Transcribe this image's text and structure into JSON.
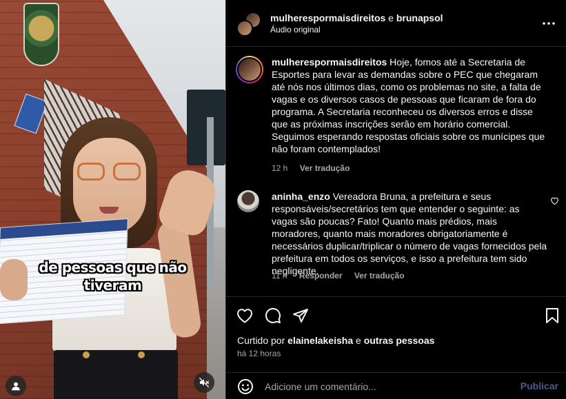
{
  "media": {
    "caption_line1": "de pessoas que não",
    "caption_line2": "tiveram"
  },
  "header": {
    "author": "mulherespormaisdireitos",
    "connector": "e",
    "collaborator": "brunapsol",
    "audio": "Áudio original"
  },
  "post": {
    "username": "mulherespormaisdireitos",
    "text": "Hoje, fomos até a Secretaria de Esportes para levar as demandas sobre o PEC que chegaram até nós nos últimos dias, como os problemas no site, a falta de vagas e os diversos casos de pessoas que ficaram de fora do programa. A Secretaria reconheceu os diversos erros e disse que as próximas inscrições serão em horário comercial. Seguimos esperando respostas oficiais sobre os munícipes que não foram contemplados!",
    "time": "12 h",
    "translate": "Ver tradução"
  },
  "comments": [
    {
      "username": "aninha_enzo",
      "text": "Vereadora Bruna, a prefeitura e seus responsáveis/secretários tem que entender o seguinte: as vagas são poucas? Fato! Quanto mais prédios, mais moradores, quanto mais moradores obrigatoriamente é necessários duplicar/triplicar o número de vagas fornecidos pela prefeitura em todos os serviços, e isso a prefeitura tem sido negligente.",
      "time": "11 h",
      "reply": "Responder",
      "translate": "Ver tradução"
    }
  ],
  "likes": {
    "prefix": "Curtido por",
    "user": "elainelakeisha",
    "connector": "e",
    "others": "outras pessoas"
  },
  "timeago": "há 12 horas",
  "add_comment": {
    "placeholder": "Adicione um comentário...",
    "publish": "Publicar"
  },
  "icons": {
    "more": "more-options-icon",
    "like": "heart-icon",
    "comment": "comment-bubble-icon",
    "share": "paper-plane-icon",
    "save": "bookmark-icon",
    "emoji": "smiley-icon",
    "user": "user-icon",
    "mute": "speaker-muted-icon"
  },
  "colors": {
    "background": "#000000",
    "primary_text": "#f5f5f5",
    "secondary_text": "#a8a8a8",
    "divider": "#262626",
    "publish_disabled": "#4a5d8a"
  }
}
